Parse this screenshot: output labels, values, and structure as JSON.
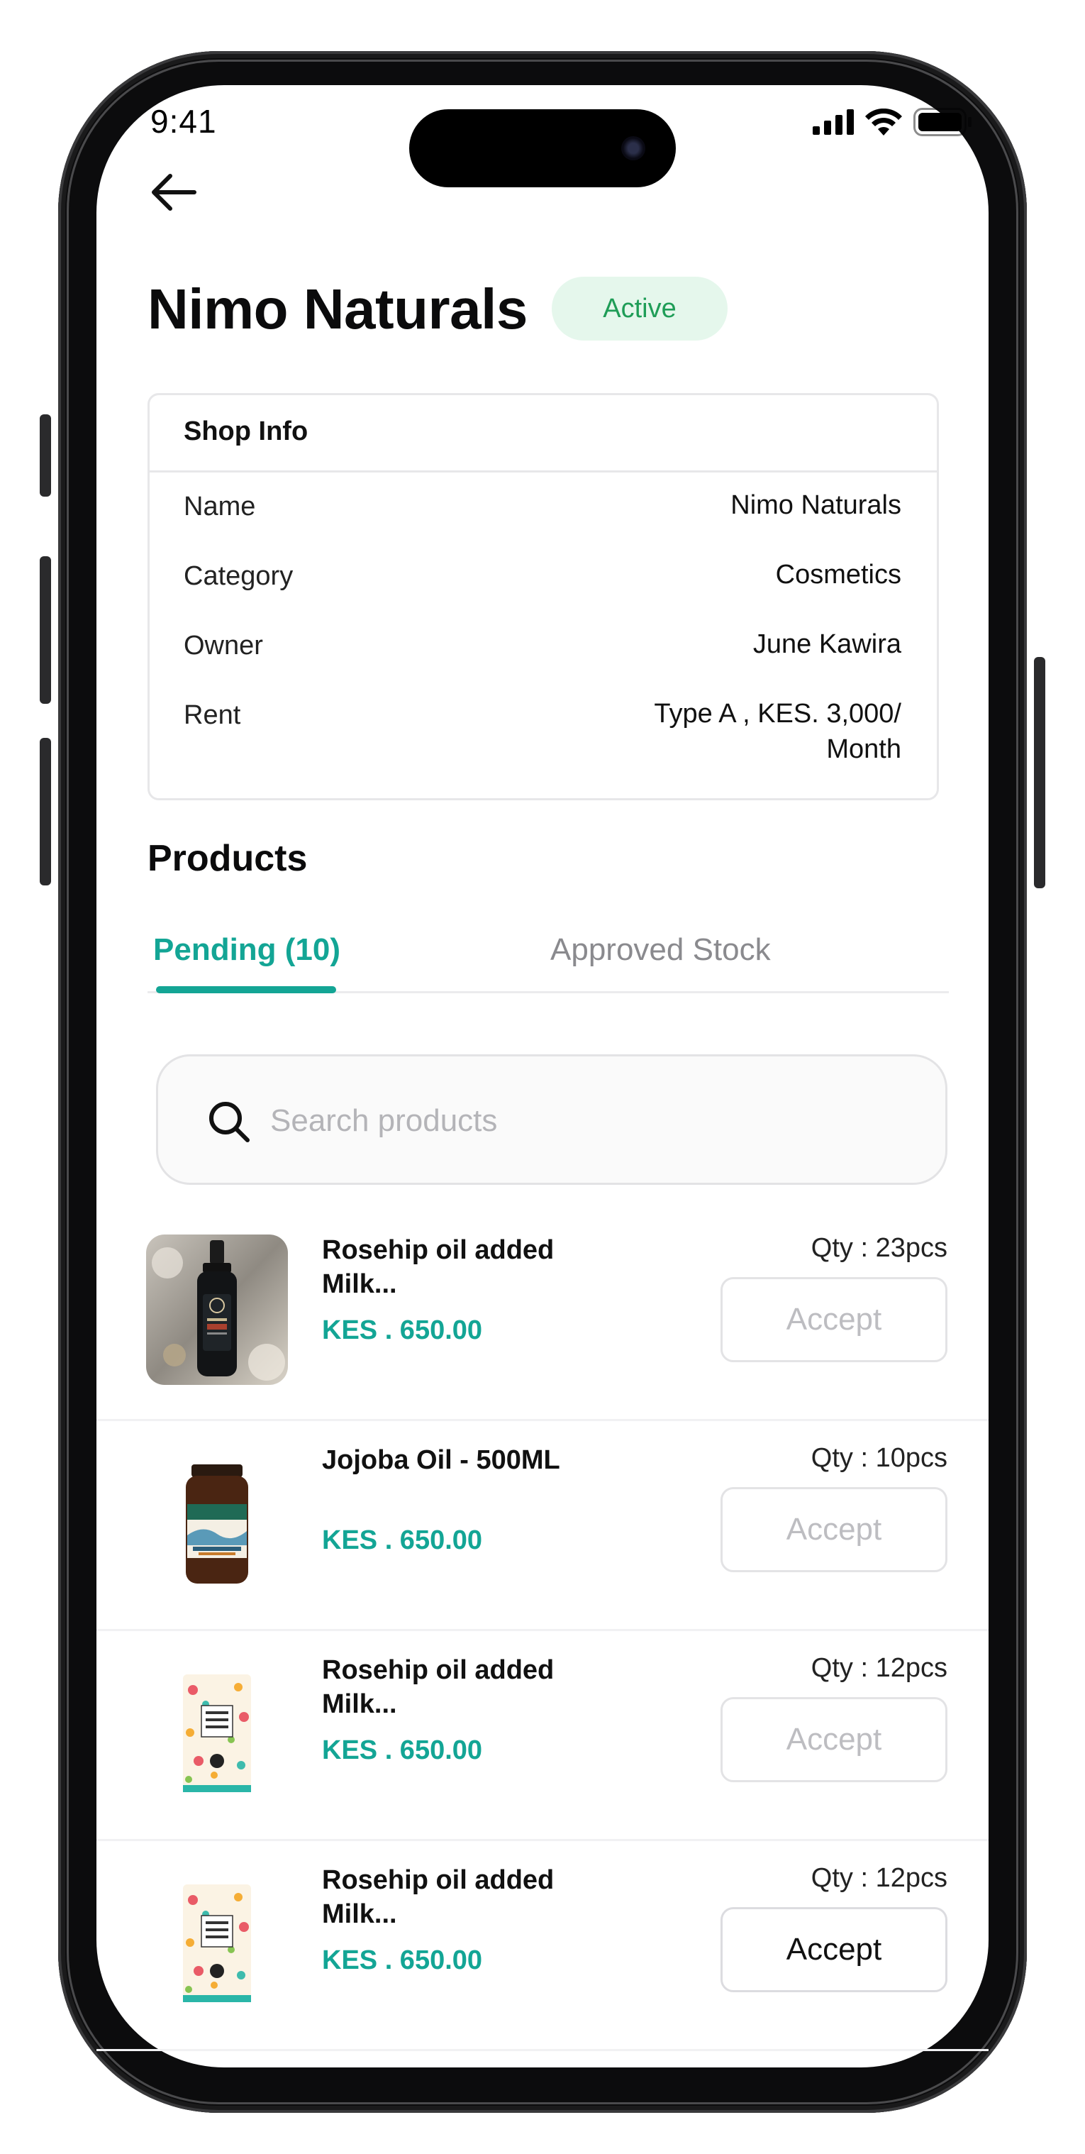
{
  "status_bar": {
    "time": "9:41"
  },
  "header": {
    "title": "Nimo Naturals",
    "status_badge": "Active"
  },
  "shop_info": {
    "heading": "Shop Info",
    "rows": [
      {
        "label": "Name",
        "value": "Nimo Naturals"
      },
      {
        "label": "Category",
        "value": "Cosmetics"
      },
      {
        "label": "Owner",
        "value": "June Kawira"
      },
      {
        "label": "Rent",
        "value_line1": "Type A , KES. 3,000/",
        "value_line2": "Month"
      }
    ]
  },
  "products": {
    "heading": "Products",
    "tabs": [
      {
        "label": "Pending (10)",
        "active": true
      },
      {
        "label": "Approved Stock",
        "active": false
      }
    ],
    "search": {
      "placeholder": "Search products",
      "value": ""
    },
    "items": [
      {
        "name_line1": "Rosehip oil added",
        "name_line2": "Milk...",
        "price": "KES . 650.00",
        "qty": "Qty : 23pcs",
        "action": "Accept",
        "enabled": false,
        "image": "serum-bottle"
      },
      {
        "name_line1": "Jojoba Oil - 500ML",
        "name_line2": "",
        "price": "KES . 650.00",
        "qty": "Qty : 10pcs",
        "action": "Accept",
        "enabled": false,
        "image": "supplement-jar"
      },
      {
        "name_line1": "Rosehip oil added",
        "name_line2": "Milk...",
        "price": "KES . 650.00",
        "qty": "Qty : 12pcs",
        "action": "Accept",
        "enabled": false,
        "image": "sugar-pouch"
      },
      {
        "name_line1": "Rosehip oil added",
        "name_line2": "Milk...",
        "price": "KES . 650.00",
        "qty": "Qty : 12pcs",
        "action": "Accept",
        "enabled": true,
        "image": "sugar-pouch"
      }
    ]
  },
  "colors": {
    "accent": "#13a595",
    "badge_bg": "#e5f7ec",
    "badge_text": "#1f9d57"
  }
}
